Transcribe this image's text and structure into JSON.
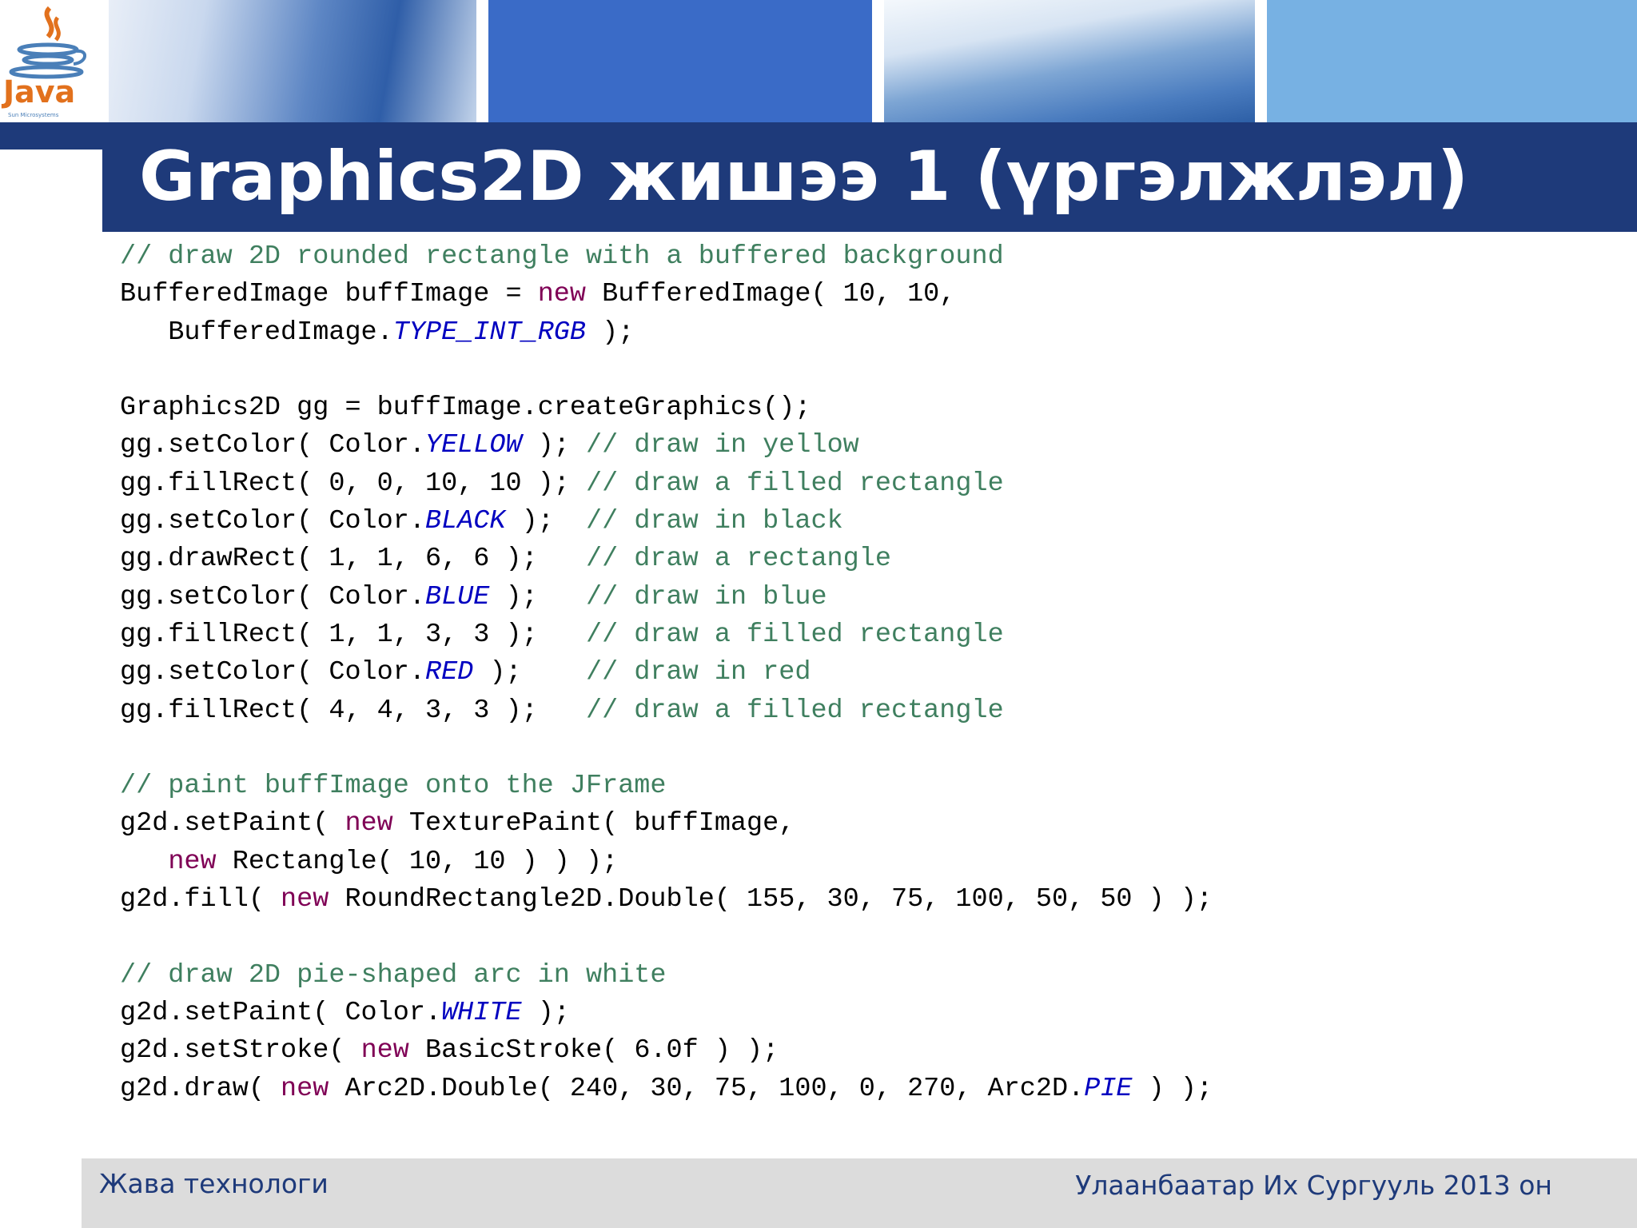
{
  "slide": {
    "title": "Graphics2D жишээ 1 (үргэлжлэл)",
    "logo_text": "Java",
    "logo_subtext": "Sun Microsystems"
  },
  "code": {
    "lines": [
      [
        {
          "t": "// draw 2D rounded rectangle with a buffered background",
          "k": "comment"
        }
      ],
      [
        {
          "t": "BufferedImage buffImage = ",
          "k": "plain"
        },
        {
          "t": "new",
          "k": "keyword"
        },
        {
          "t": " BufferedImage( 10, 10,",
          "k": "plain"
        }
      ],
      [
        {
          "t": "   BufferedImage.",
          "k": "plain"
        },
        {
          "t": "TYPE_INT_RGB",
          "k": "const"
        },
        {
          "t": " );",
          "k": "plain"
        }
      ],
      [],
      [
        {
          "t": "Graphics2D gg = buffImage.createGraphics();",
          "k": "plain"
        }
      ],
      [
        {
          "t": "gg.setColor( Color.",
          "k": "plain"
        },
        {
          "t": "YELLOW",
          "k": "const"
        },
        {
          "t": " ); ",
          "k": "plain"
        },
        {
          "t": "// draw in yellow",
          "k": "comment"
        }
      ],
      [
        {
          "t": "gg.fillRect( 0, 0, 10, 10 ); ",
          "k": "plain"
        },
        {
          "t": "// draw a filled rectangle",
          "k": "comment"
        }
      ],
      [
        {
          "t": "gg.setColor( Color.",
          "k": "plain"
        },
        {
          "t": "BLACK",
          "k": "const"
        },
        {
          "t": " );  ",
          "k": "plain"
        },
        {
          "t": "// draw in black",
          "k": "comment"
        }
      ],
      [
        {
          "t": "gg.drawRect( 1, 1, 6, 6 );   ",
          "k": "plain"
        },
        {
          "t": "// draw a rectangle",
          "k": "comment"
        }
      ],
      [
        {
          "t": "gg.setColor( Color.",
          "k": "plain"
        },
        {
          "t": "BLUE",
          "k": "const"
        },
        {
          "t": " );   ",
          "k": "plain"
        },
        {
          "t": "// draw in blue",
          "k": "comment"
        }
      ],
      [
        {
          "t": "gg.fillRect( 1, 1, 3, 3 );   ",
          "k": "plain"
        },
        {
          "t": "// draw a filled rectangle",
          "k": "comment"
        }
      ],
      [
        {
          "t": "gg.setColor( Color.",
          "k": "plain"
        },
        {
          "t": "RED",
          "k": "const"
        },
        {
          "t": " );    ",
          "k": "plain"
        },
        {
          "t": "// draw in red",
          "k": "comment"
        }
      ],
      [
        {
          "t": "gg.fillRect( 4, 4, 3, 3 );   ",
          "k": "plain"
        },
        {
          "t": "// draw a filled rectangle",
          "k": "comment"
        }
      ],
      [],
      [
        {
          "t": "// paint buffImage onto the JFrame",
          "k": "comment"
        }
      ],
      [
        {
          "t": "g2d.setPaint( ",
          "k": "plain"
        },
        {
          "t": "new",
          "k": "keyword"
        },
        {
          "t": " TexturePaint( buffImage,",
          "k": "plain"
        }
      ],
      [
        {
          "t": "   ",
          "k": "plain"
        },
        {
          "t": "new",
          "k": "keyword"
        },
        {
          "t": " Rectangle( 10, 10 ) ) );",
          "k": "plain"
        }
      ],
      [
        {
          "t": "g2d.fill( ",
          "k": "plain"
        },
        {
          "t": "new",
          "k": "keyword"
        },
        {
          "t": " RoundRectangle2D.Double( 155, 30, 75, 100, 50, 50 ) );",
          "k": "plain"
        }
      ],
      [],
      [
        {
          "t": "// draw 2D pie-shaped arc in white",
          "k": "comment"
        }
      ],
      [
        {
          "t": "g2d.setPaint( Color.",
          "k": "plain"
        },
        {
          "t": "WHITE",
          "k": "const"
        },
        {
          "t": " );",
          "k": "plain"
        }
      ],
      [
        {
          "t": "g2d.setStroke( ",
          "k": "plain"
        },
        {
          "t": "new",
          "k": "keyword"
        },
        {
          "t": " BasicStroke( 6.0f ) );",
          "k": "plain"
        }
      ],
      [
        {
          "t": "g2d.draw( ",
          "k": "plain"
        },
        {
          "t": "new",
          "k": "keyword"
        },
        {
          "t": " Arc2D.Double( 240, 30, 75, 100, 0, 270, Arc2D.",
          "k": "plain"
        },
        {
          "t": "PIE",
          "k": "const"
        },
        {
          "t": " ) );",
          "k": "plain"
        }
      ]
    ]
  },
  "footer": {
    "left": "Жава технологи",
    "right": "Улаанбаатар Их Сургууль 2013 он"
  },
  "colors": {
    "title_bar": "#1e3a7a",
    "banner_blue": "#3a6bc7",
    "banner_light_blue": "#77b1e3",
    "comment": "#3f7f5f",
    "keyword": "#7f0055",
    "constant": "#0000c0",
    "footer_bg": "#dcdcdc"
  },
  "icons": {
    "logo": "java-coffee-cup-icon"
  }
}
